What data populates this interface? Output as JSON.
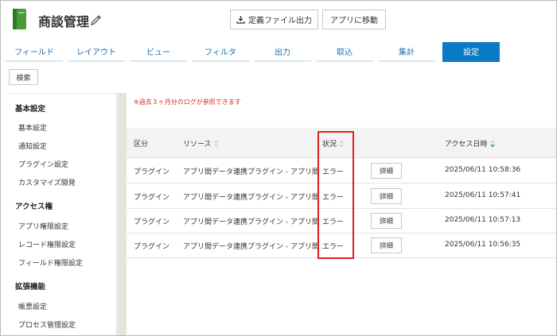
{
  "header": {
    "app_title": "商談管理",
    "export_button": "定義ファイル出力",
    "goto_app_button": "アプリに移動"
  },
  "tabs": [
    {
      "label": "フィールド"
    },
    {
      "label": "レイアウト"
    },
    {
      "label": "ビュー"
    },
    {
      "label": "フィルタ"
    },
    {
      "label": "出力"
    },
    {
      "label": "取込"
    },
    {
      "label": "集計"
    },
    {
      "label": "設定"
    }
  ],
  "search_button": "検索",
  "sidebar": {
    "basic_heading": "基本設定",
    "basic_items": [
      "基本設定",
      "通知設定",
      "プラグイン設定",
      "カスタマイズ開発"
    ],
    "access_heading": "アクセス権",
    "access_items": [
      "アプリ権限設定",
      "レコード権限設定",
      "フィールド権限設定"
    ],
    "ext_heading": "拡張機能",
    "ext_items": [
      "帳票設定",
      "プロセス管理設定"
    ]
  },
  "main": {
    "notice": "※過去３ヶ月分のログが参照できます",
    "columns": {
      "category": "区分",
      "resource": "リソース",
      "status": "状況",
      "access_time": "アクセス日時"
    },
    "detail_label": "詳細",
    "rows": [
      {
        "category": "プラグイン",
        "resource": "アプリ間データ連携プラグイン - アプリ間データ連携",
        "status": "エラー",
        "time": "2025/06/11 10:58:36"
      },
      {
        "category": "プラグイン",
        "resource": "アプリ間データ連携プラグイン - アプリ間データ連携",
        "status": "エラー",
        "time": "2025/06/11 10:57:41"
      },
      {
        "category": "プラグイン",
        "resource": "アプリ間データ連携プラグイン - アプリ間データ連携",
        "status": "エラー",
        "time": "2025/06/11 10:57:13"
      },
      {
        "category": "プラグイン",
        "resource": "アプリ間データ連携プラグイン - アプリ間データ連携",
        "status": "エラー",
        "time": "2025/06/11 10:56:35"
      }
    ]
  },
  "colors": {
    "accent": "#0b7ac4",
    "notice": "#d0342c",
    "highlight": "#e0201d"
  }
}
